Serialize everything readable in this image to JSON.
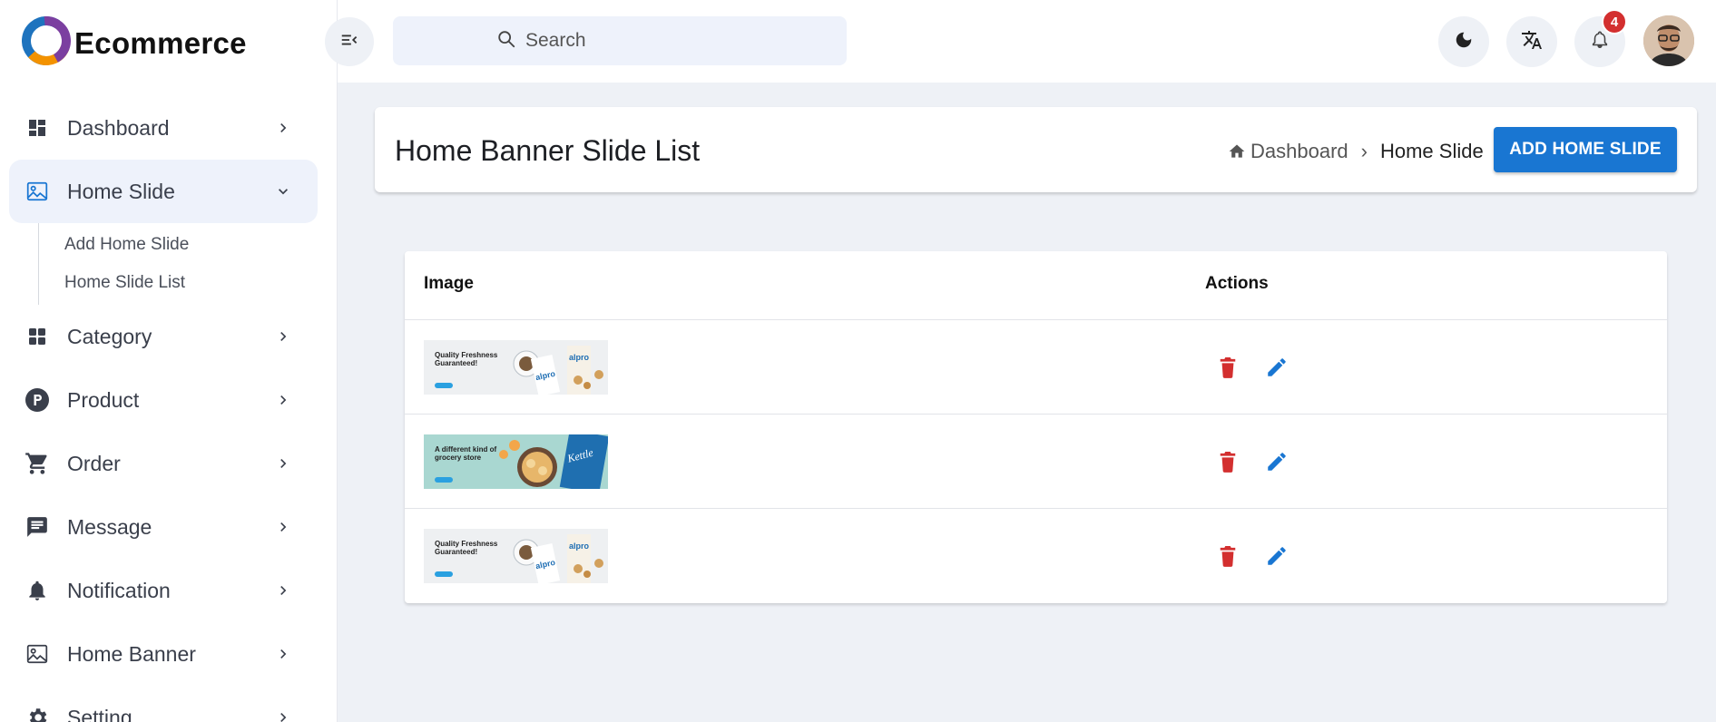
{
  "brand": {
    "name": "Ecommerce"
  },
  "sidebar": {
    "items": [
      {
        "label": "Dashboard",
        "icon": "dashboard-icon"
      },
      {
        "label": "Home Slide",
        "icon": "image-icon",
        "expanded": true,
        "subitems": [
          "Add Home Slide",
          "Home Slide List"
        ]
      },
      {
        "label": "Category",
        "icon": "grid-icon"
      },
      {
        "label": "Product",
        "icon": "product-icon"
      },
      {
        "label": "Order",
        "icon": "cart-icon"
      },
      {
        "label": "Message",
        "icon": "message-icon"
      },
      {
        "label": "Notification",
        "icon": "bell-icon"
      },
      {
        "label": "Home Banner",
        "icon": "image-icon"
      },
      {
        "label": "Setting",
        "icon": "gear-icon"
      }
    ]
  },
  "header": {
    "search_placeholder": "Search",
    "notification_count": "4",
    "icons": [
      "menu-toggle-icon",
      "search-icon",
      "moon-icon",
      "translate-icon",
      "bell-icon",
      "avatar"
    ]
  },
  "page": {
    "title": "Home Banner Slide List",
    "breadcrumb": {
      "home": "Dashboard",
      "separator": "›",
      "current": "Home Slide"
    },
    "add_button": "ADD HOME SLIDE"
  },
  "table": {
    "columns": [
      "Image",
      "Actions"
    ],
    "rows": [
      {
        "headline_1": "Quality Freshness",
        "headline_2": "Guaranteed!",
        "brand": "alpro",
        "theme": "light"
      },
      {
        "headline_1": "A different kind of",
        "headline_2": "grocery store",
        "brand": "Kettle",
        "theme": "teal"
      },
      {
        "headline_1": "Quality Freshness",
        "headline_2": "Guaranteed!",
        "brand": "alpro",
        "theme": "light"
      }
    ]
  },
  "colors": {
    "accent": "#1976d2",
    "delete": "#d32f2f",
    "edit": "#1976d2",
    "sidebar_active_bg": "#eef2fb",
    "page_bg": "#eef1f6"
  }
}
